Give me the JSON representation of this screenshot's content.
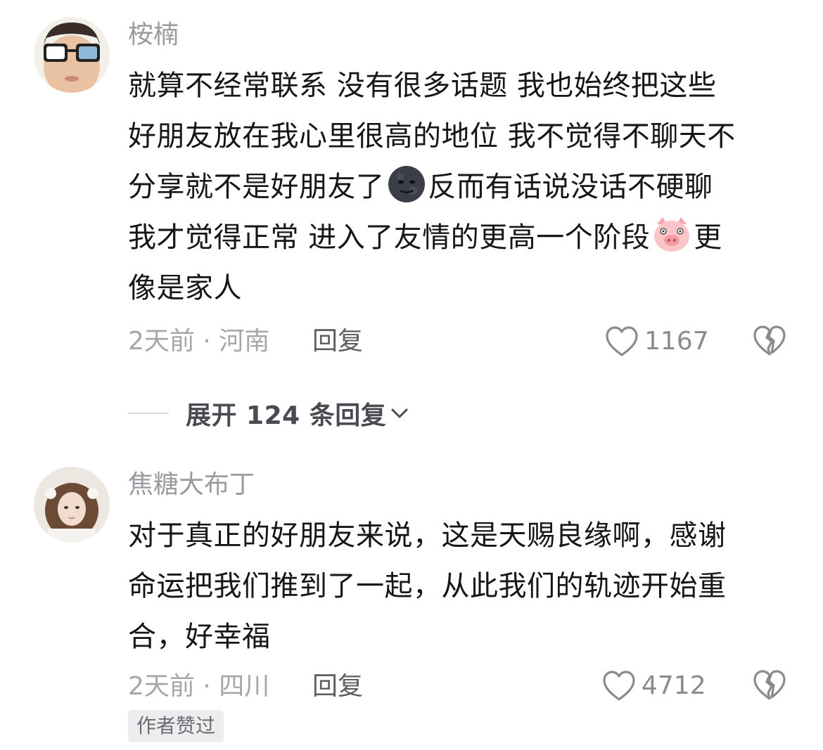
{
  "comments": [
    {
      "username": "桉楠",
      "lines": [
        "就算不经常联系 没有很多话题 我也始终把这些",
        "好朋友放在我心里很高的地位 我不觉得不聊天不",
        "分享就不是好朋友了",
        "反而有话说没话不硬聊",
        "我才觉得正常 进入了友情的更高一个阶段",
        "更",
        "像是家人"
      ],
      "emoji_1": "moon-face-emoji",
      "emoji_2": "pig-face-emoji",
      "time": "2天前",
      "location": "河南",
      "reply": "回复",
      "likes": "1167"
    },
    {
      "username": "焦糖大布丁",
      "lines": [
        "对于真正的好朋友来说，这是天赐良缘啊，感谢",
        "命运把我们推到了一起，从此我们的轨迹开始重",
        "合，好幸福"
      ],
      "time": "2天前",
      "location": "四川",
      "reply": "回复",
      "likes": "4712",
      "badge": "作者赞过"
    }
  ],
  "expand_replies": "展开 124 条回复",
  "separator": "·"
}
